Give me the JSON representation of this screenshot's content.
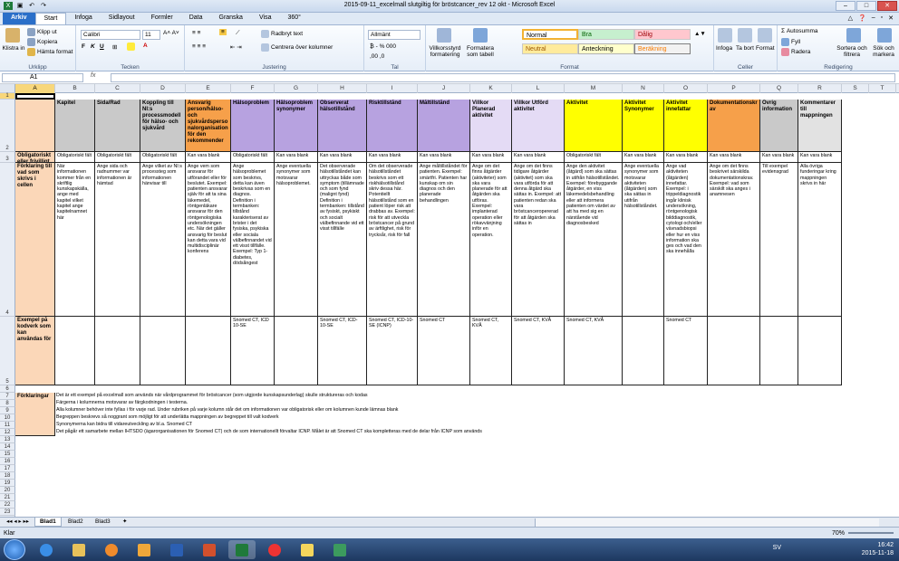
{
  "window": {
    "title": "2015-09-11_excelmall slutgiltig för bröstcancer_rev 12 okt  -  Microsoft Excel"
  },
  "tabs": [
    "Arkiv",
    "Start",
    "Infoga",
    "Sidlayout",
    "Formler",
    "Data",
    "Granska",
    "Visa",
    "360°"
  ],
  "ribbon": {
    "clipboard": {
      "paste": "Klistra in",
      "cut": "Klipp ut",
      "copy": "Kopiera",
      "painter": "Hämta format",
      "label": "Urklipp"
    },
    "font": {
      "name": "Calibri",
      "size": "11",
      "label": "Tecken"
    },
    "align": {
      "wrap": "Radbryt text",
      "merge": "Centrera över kolumner",
      "label": "Justering"
    },
    "number": {
      "format": "Allmänt",
      "label": "Tal"
    },
    "styles": {
      "cond": "Villkorsstyrd formatering",
      "table": "Formatera som tabell",
      "normal": "Normal",
      "bra": "Bra",
      "dalig": "Dålig",
      "neutral": "Neutral",
      "anteckning": "Anteckning",
      "berakning": "Beräkning",
      "label": "Format"
    },
    "cells": {
      "insert": "Infoga",
      "delete": "Ta bort",
      "format": "Format",
      "label": "Celler"
    },
    "editing": {
      "autosum": "Autosumma",
      "fill": "Fyll",
      "clear": "Radera",
      "sort": "Sortera och filtrera",
      "find": "Sök och markera",
      "label": "Redigering"
    }
  },
  "formula_bar": {
    "name_box": "A1",
    "fx": "fx",
    "value": ""
  },
  "columns": [
    "A",
    "B",
    "C",
    "D",
    "E",
    "F",
    "G",
    "H",
    "I",
    "J",
    "K",
    "L",
    "M",
    "N",
    "O",
    "P",
    "Q",
    "R",
    "S",
    "T"
  ],
  "rows": [
    "1",
    "2",
    "3",
    "4",
    "5",
    "6",
    "7",
    "8",
    "9",
    "10",
    "11",
    "12",
    "13",
    "14",
    "15",
    "16",
    "17",
    "18",
    "19",
    "20",
    "21",
    "22",
    "23",
    "24",
    "25",
    "26",
    "27",
    "28",
    "29",
    "30",
    "31",
    "32",
    "33",
    "34",
    "35"
  ],
  "headers": [
    "Kapitel",
    "Sida/Rad",
    "Koppling till NI:s processmodell för hälso- och sjukvård",
    "Ansvarig person/hälso- och sjukvårdspersonalorganisation för den rekommender",
    "Hälsoproblem",
    "Hälsoproblem synonymer",
    "Observerat hälsotillstånd",
    "Risktillstånd",
    "Måltillstånd",
    "Villkor Planerad aktivitet",
    "Villkor Utförd aktivitet",
    "Aktivitet",
    "Aktivitet Synonymer",
    "Aktivitet innefattar",
    "Dokumentationskrav",
    "Övrig information",
    "Kommentarer till mappningen"
  ],
  "row3": {
    "label": "Obligatoriskt eller frivilligt fält",
    "values": [
      "Obligatoriskt fält",
      "Obligatoriskt fält",
      "Obligatoriskt fält",
      "Kan vara blank",
      "Obligatoriskt fält",
      "Kan vara blank",
      "Kan vara blank",
      "Kan vara blank",
      "Kan vara blank",
      "Kan vara blank",
      "Kan vara blank",
      "Obligatoriskt fält",
      "Kan vara blank",
      "Kan vara blank",
      "Kan vara blank",
      "Kan vara blank",
      "Kan vara blank"
    ]
  },
  "row4": {
    "label": "Förklaring till vad som skrivs i cellen",
    "values": [
      "När informationen kommer från en skriftlig kunskapskälla, ange med kapitel vilket kapitel ange kapitelnamnet här",
      "Ange sida och radnummer var informationen är hämtad",
      "Ange vilket av NI:s processteg som informationen hänvisar till",
      "Ange vem som ansvarar för utförandet eller för beslutet. Exempel: patienten ansvarar själv för att ta sina läkemedel, röntgenläkare ansvarar för den röntgenologiska undersökningen etc. När det gäller ansvarig för beslut kan detta vara vid multidisciplinär konferens",
      "Ange hälsoproblemet som beskrivs, detta kan även beskrivas som en diagnos. Definition i termbanken: tillstånd karakteriserat av brister i det fysiska, psykiska eller sociala välbefinnandet vid ett visst tillfälle. Exempel: Typ 1-diabetes, dödsångest",
      "Ange eventuella synonymer som motsvarar hälsoproblemet.",
      "Det observerade hälsotillståndet kan uttryckas både som symptom (tillämnade och som fynd (malignt fynd) Definition i termbanken: tillstånd av fysiskt, psykiskt och socialt välbefinnande vid ett visst tillfälle",
      "Om det observerade hälsotillståndet beskrivs som ett riskhälsotillstånd skriv dessa här. Potentiellt hälsotillstånd som en patient löper risk att drabbas av. Exempel: risk för att utveckla bröstcancer på grund av ärftlighet, risk för trycksår, risk för fall",
      "Ange måltillståndet för patienten. Exempel: smärtfri. Patienten har kunskap om sin diagnos och den planerade behandlingen",
      "Ange om det finns åtgärder (aktiviteter) som ska vara planerade för att åtgärden ska utföras. Exempel: implanterad operation eller rökavvänjning inför en operation.",
      "Ange om det finns tidigare åtgärder (aktivitet) som ska vara utförda för att denna åtgärd ska sättas in. Exempel: att patienten redan ska vara bröstcanceropererad för att åtgärden ska sättas in",
      "Ange den aktivitet (åtgärd) som ska sättas in utifrån hälsotillståndet. Exempel: förebyggande åtgärder, en viss läkemedelsbehandling eller att informera patienten om värdet av att ha med sig en närstående vid diagnosbesked",
      "Ange eventuella synonymer som motsvarar aktiviteten (åtgärden) som ska sättas in utifrån hälsotillståndet.",
      "Ange vad aktiviteten (åtgärden) innefattar. Exempel: i trippeldiagnostik ingår klinisk undersökning, röntgenologisk bilddiagnostik, cytologi och/eller vävnadsbiopsi eller hur en viss information ska ges och vad den ska innehålla",
      "Ange om det finns beskrivet särskilda dokumentationskrav. Exempel: vad som särskilt ska anges i anamnesen",
      "Till exempel evidensgrad",
      "Alla övriga funderingar kring mappningen skrivs in här"
    ]
  },
  "row5": {
    "label": "Exempel på kodverk som kan användas för",
    "values": [
      "",
      "",
      "",
      "",
      "Snomed CT, ICD 10-SE",
      "",
      "Snomed CT, ICD-10-SE",
      "Snomed CT, ICD-10-SE (ICNP)",
      "Snomed CT",
      "Snomed CT, KVÅ",
      "Snomed CT, KVÅ",
      "Snomed CT, KVÅ",
      "",
      "Snomed CT",
      "",
      "",
      ""
    ]
  },
  "notes": {
    "label": "Förklaringar",
    "lines": [
      "Det är ett exempel på excelmall som används när vårdprogrammet för bröstcancer (som utgjorde kunskapsunderlag) skulle struktureras och kodas",
      "Färgerna i kolumnerna motsvarar av färgkodningen i testerna.",
      "Alla kolumner behöver inte fyllas i för varje rad. Under rubriken på varje kolumn står det om informationen var obligatorisk eller om kolumnen kunde lämnas blank",
      "Begreppen beskrevs så noggrant som möjligt för att underlätta mappningen av begreppet till valt kodverk",
      "Synonymerna kan bidra till vidareutveckling av bl.a. Snomed CT",
      "Det pågår ett samarbete mellan IHTSDO (ägarorganisationen för Snomed CT) och de som internationellt förvaltar ICNP. Målet är att Snomed CT ska kompletteras med de delar från ICNP som används"
    ]
  },
  "sheets": [
    "Blad1",
    "Blad2",
    "Blad3"
  ],
  "status": {
    "left": "Klar",
    "zoom": "70%"
  },
  "tray": {
    "lang": "SV",
    "time": "16:42",
    "date": "2015-11-18"
  },
  "colors": {
    "purple": "#b7a2e0",
    "gray": "#c9c9c9",
    "yellow": "#ffff00",
    "orange": "#f6a04a",
    "peach": "#fbd7b8",
    "lightpurple": "#e4dbf5",
    "lightgray": "#e2e2e2"
  }
}
